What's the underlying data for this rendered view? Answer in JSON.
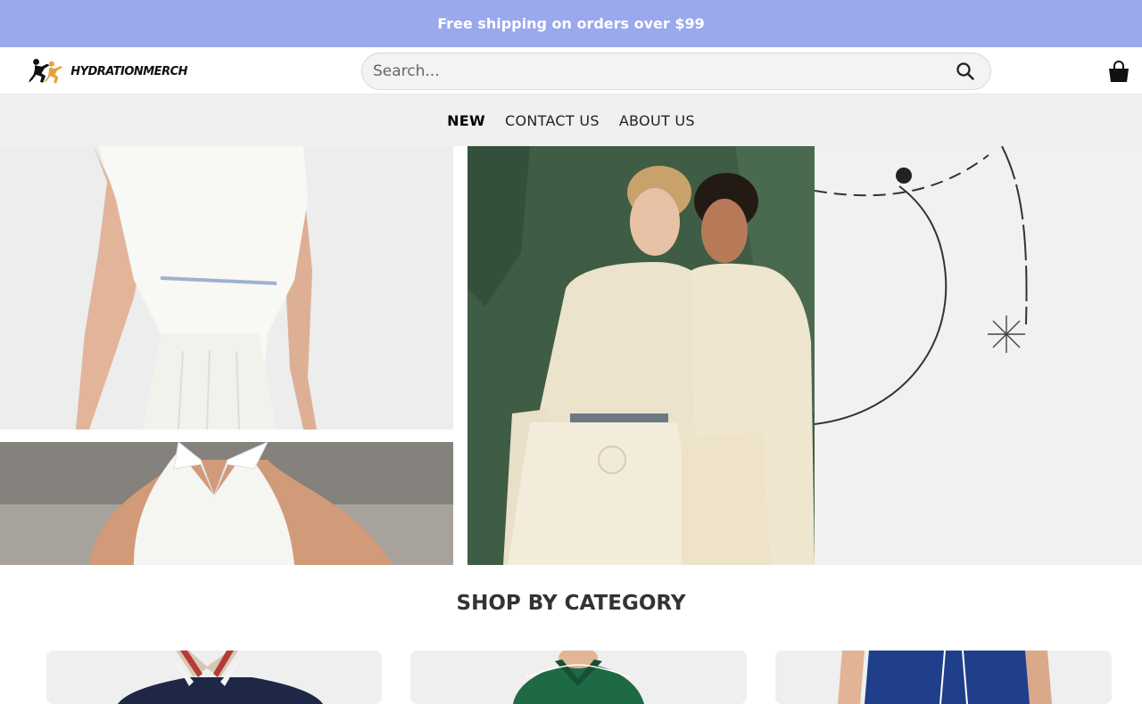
{
  "announcement": {
    "text": "Free shipping on orders over $99"
  },
  "header": {
    "logo_text": "HYDRATIONMERCH",
    "search": {
      "placeholder": "Search...",
      "value": ""
    },
    "icons": [
      "search-icon",
      "shopping-bag-icon"
    ]
  },
  "nav": {
    "items": [
      {
        "label": "NEW",
        "active": true
      },
      {
        "label": "CONTACT US",
        "active": false
      },
      {
        "label": "ABOUT US",
        "active": false
      }
    ]
  },
  "hero": {
    "panels": [
      "white-pleated-tennis-dress-back",
      "white-collared-halter-top",
      "two-women-in-cream-tennis-polos",
      "minimal-tennis-line-art"
    ]
  },
  "categories": {
    "title": "SHOP BY CATEGORY",
    "items": [
      "navy-striped-collar-jacket",
      "green-polo-shirt",
      "navy-tennis-shorts"
    ]
  },
  "colors": {
    "announcement_bg": "#9aa8ec",
    "nav_bg": "#f0f0f0",
    "search_bg": "#f3f3f3"
  }
}
